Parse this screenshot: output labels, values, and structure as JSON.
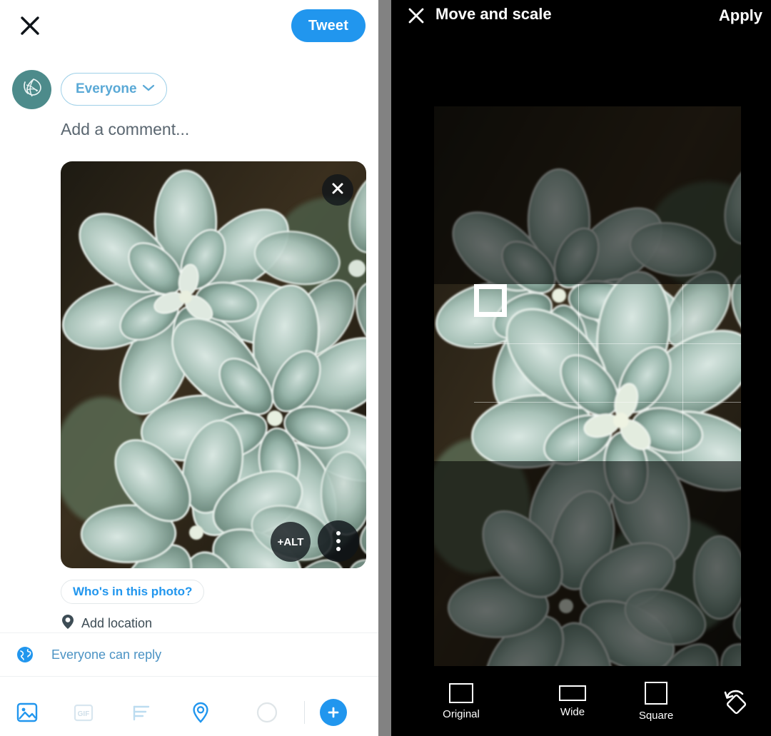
{
  "composer": {
    "close_icon": "close-x-icon",
    "tweet_button": "Tweet",
    "avatar_icon": "leaf-avatar-icon",
    "audience": {
      "label": "Everyone",
      "chevron_icon": "chevron-down-icon"
    },
    "comment_placeholder": "Add a comment...",
    "media": {
      "remove_icon": "close-x-icon",
      "alt_badge_label": "+ALT",
      "more_icon": "more-vertical-icon",
      "alt_text": "Close-up photograph of pale green succulent rosettes"
    },
    "tag_chip": "Who's in this photo?",
    "add_location": {
      "icon": "location-pin-icon",
      "label": "Add location"
    },
    "reply_setting": {
      "icon": "globe-icon",
      "label": "Everyone can reply"
    },
    "toolbar": [
      {
        "name": "media-icon",
        "label": "Media",
        "state": "active"
      },
      {
        "name": "gif-icon",
        "label": "GIF",
        "state": "disabled"
      },
      {
        "name": "poll-icon",
        "label": "Poll",
        "state": "muted"
      },
      {
        "name": "location-icon",
        "label": "Location",
        "state": "active"
      },
      {
        "name": "character-count-icon",
        "label": "Character count",
        "state": "empty"
      },
      {
        "name": "add-tweet-icon",
        "label": "+",
        "state": "active"
      }
    ]
  },
  "cropper": {
    "close_icon": "close-x-icon",
    "title": "Move and scale",
    "apply_button": "Apply",
    "photo_alt": "Close-up photograph of pale green succulent rosettes",
    "modes": [
      {
        "id": "original",
        "label": "Original",
        "shape": "original"
      },
      {
        "id": "wide",
        "label": "Wide",
        "shape": "wide"
      },
      {
        "id": "square",
        "label": "Square",
        "shape": "square"
      }
    ],
    "rotate_icon": "rotate-icon"
  },
  "colors": {
    "twitter_blue": "#2196ee",
    "chip_blue": "#5aa9d6",
    "avatar_teal": "#4d8b8b",
    "divider_gray": "#828282",
    "crop_bg": "#000000",
    "text_dark": "#3d4c55"
  }
}
